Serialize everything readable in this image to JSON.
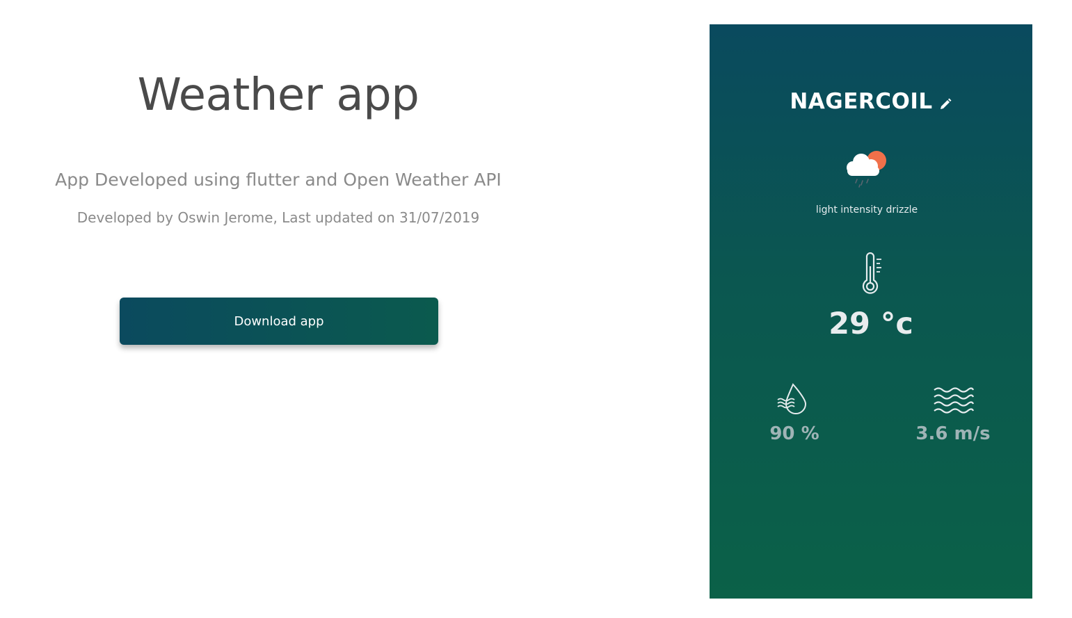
{
  "page": {
    "title": "Weather app",
    "subtitle": "App Developed using flutter and Open Weather API",
    "credit": "Developed by Oswin Jerome, Last updated on 31/07/2019",
    "download_label": "Download app"
  },
  "phone": {
    "city": "NAGERCOIL",
    "description": "light intensity drizzle",
    "temperature": "29 °c",
    "humidity": "90 %",
    "wind": "3.6 m/s",
    "icons": [
      "edit-icon",
      "cloud-rain-sun-icon",
      "thermometer-icon",
      "humidity-icon",
      "wind-icon"
    ]
  },
  "colors": {
    "button_gradient": [
      "#0b4a5e",
      "#0b5a4e"
    ],
    "phone_gradient": [
      "#0a4a5e",
      "#0b6148"
    ],
    "sun": "#f0704a"
  }
}
